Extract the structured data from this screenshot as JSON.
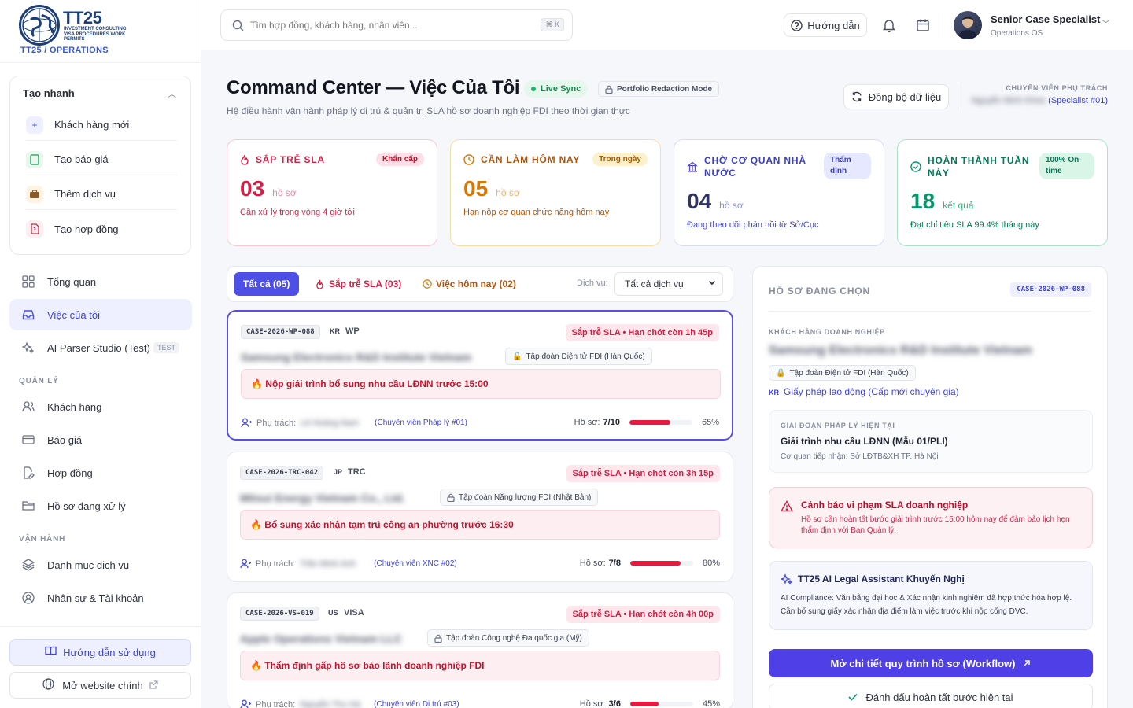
{
  "brand": {
    "name": "TT25",
    "sub": "INVESTMENT CONSULTING VISA PROCEDURES WORK PERMITS",
    "tenant": "TT25 / OPERATIONS"
  },
  "quick_create": {
    "title": "Tạo nhanh",
    "items": [
      {
        "label": "Khách hàng mới",
        "icon": "plus-icon"
      },
      {
        "label": "Tạo báo giá",
        "icon": "document-icon"
      },
      {
        "label": "Thêm dịch vụ",
        "icon": "briefcase-icon"
      },
      {
        "label": "Tạo hợp đồng",
        "icon": "contract-icon"
      }
    ]
  },
  "nav": {
    "overview": "Tổng quan",
    "my_work": "Việc của tôi",
    "ai_parser": "AI Parser Studio (Test)",
    "ai_parser_tag": "TEST",
    "section_manage": "QUẢN LÝ",
    "customers": "Khách hàng",
    "quotes": "Báo giá",
    "contracts": "Hợp đồng",
    "cases": "Hồ sơ đang xử lý",
    "section_ops": "VẬN HÀNH",
    "services": "Danh mục dịch vụ",
    "staff": "Nhân sự & Tài khoản",
    "guide_button": "Hướng dẫn sử dụng",
    "website_button": "Mở website chính"
  },
  "topbar": {
    "search_placeholder": "Tìm hợp đồng, khách hàng, nhân viên...",
    "shortcut": "⌘ K",
    "help": "Hướng dẫn",
    "user_name": "Senior Case Specialist",
    "user_role": "Operations OS"
  },
  "header": {
    "title": "Command Center — Việc Của Tôi",
    "live": "Live Sync",
    "redaction": "Portfolio Redaction Mode",
    "subtitle": "Hệ điều hành vận hành pháp lý di trú & quản trị SLA hồ sơ doanh nghiệp FDI theo thời gian thực",
    "sync_button": "Đồng bộ dữ liệu",
    "owner_label": "CHUYÊN VIÊN PHỤ TRÁCH",
    "owner_name": "Nguyễn Minh Khoa",
    "owner_role": "(Specialist #01)"
  },
  "stats": [
    {
      "title": "SẮP TRỄ SLA",
      "badge": "Khẩn cấp",
      "value": "03",
      "unit": "hồ sơ",
      "desc": "Cần xử lý trong vòng 4 giờ tới",
      "accent": "#e11d48"
    },
    {
      "title": "CẦN LÀM HÔM NAY",
      "badge": "Trong ngày",
      "value": "05",
      "unit": "hồ sơ",
      "desc": "Hạn nộp cơ quan chức năng hôm nay",
      "accent": "#d97706"
    },
    {
      "title": "CHỜ CƠ QUAN NHÀ NƯỚC",
      "badge": "Thẩm định",
      "value": "04",
      "unit": "hồ sơ",
      "desc": "Đang theo dõi phản hồi từ Sở/Cục",
      "accent": "#4f46e5"
    },
    {
      "title": "HOÀN THÀNH TUẦN NÀY",
      "badge": "100% On-time",
      "value": "18",
      "unit": "kết quả",
      "desc": "Đạt chỉ tiêu SLA 99.4% tháng này",
      "accent": "#059669"
    }
  ],
  "filters": {
    "all": "Tất cả (05)",
    "sla": "Sắp trễ SLA (03)",
    "today": "Việc hôm nay (02)",
    "service_label": "Dịch vụ:",
    "service_value": "Tất cả dịch vụ"
  },
  "cases": [
    {
      "id": "CASE-2026-WP-088",
      "country": "KR",
      "type": "WP",
      "sla": "Sắp trễ SLA • Hạn chót còn 1h 45p",
      "company": "Samsung Electronics R&D Institute Vietnam",
      "group": "Tập đoàn Điện tử FDI (Hàn Quốc)",
      "task": "🔥 Nộp giải trình bổ sung nhu cầu LĐNN trước 15:00",
      "owner_label": "Phụ trách:",
      "owner": "Lê Hoàng Nam",
      "owner_role": "(Chuyên viên Pháp lý #01)",
      "docs_label": "Hồ sơ:",
      "docs": "7/10",
      "progress": 65,
      "progress_text": "65%"
    },
    {
      "id": "CASE-2026-TRC-042",
      "country": "JP",
      "type": "TRC",
      "sla": "Sắp trễ SLA • Hạn chót còn 3h 15p",
      "company": "Mitsui Energy Vietnam Co., Ltd.",
      "group": "Tập đoàn Năng lượng FDI (Nhật Bản)",
      "task": "🔥 Bổ sung xác nhận tạm trú công an phường trước 16:30",
      "owner_label": "Phụ trách:",
      "owner": "Trần Minh Anh",
      "owner_role": "(Chuyên viên XNC #02)",
      "docs_label": "Hồ sơ:",
      "docs": "7/8",
      "progress": 80,
      "progress_text": "80%"
    },
    {
      "id": "CASE-2026-VS-019",
      "country": "US",
      "type": "VISA",
      "sla": "Sắp trễ SLA • Hạn chót còn 4h 00p",
      "company": "Apple Operations Vietnam LLC",
      "group": "Tập đoàn Công nghệ Đa quốc gia (Mỹ)",
      "task": "🔥 Thẩm định gấp hồ sơ bảo lãnh doanh nghiệp FDI",
      "owner_label": "Phụ trách:",
      "owner": "Nguyễn Thu Hà",
      "owner_role": "(Chuyên viên Di trú #03)",
      "docs_label": "Hồ sơ:",
      "docs": "3/6",
      "progress": 45,
      "progress_text": "45%"
    }
  ],
  "detail": {
    "title": "HỒ SƠ ĐANG CHỌN",
    "case_id": "CASE-2026-WP-088",
    "client_label": "KHÁCH HÀNG DOANH NGHIỆP",
    "client": "Samsung Electronics R&D Institute Vietnam",
    "group": "Tập đoàn Điện tử FDI (Hàn Quốc)",
    "service_cc": "KR",
    "service": "Giấy phép lao động (Cấp mới chuyên gia)",
    "stage_label": "GIAI ĐOẠN PHÁP LÝ HIỆN TẠI",
    "stage": "Giải trình nhu cầu LĐNN (Mẫu 01/PLI)",
    "agency": "Cơ quan tiếp nhận: Sở LĐTB&XH TP. Hà Nội",
    "alert_title": "Cảnh báo vi phạm SLA doanh nghiệp",
    "alert_text": "Hồ sơ cần hoàn tất bước giải trình trước 15:00 hôm nay để đảm bảo lịch hẹn thẩm định với Ban Quản lý.",
    "ai_title": "TT25 AI Legal Assistant Khuyến Nghị",
    "ai_text": "AI Compliance: Văn bằng đại học & Xác nhận kinh nghiệm đã hợp thức hóa hợp lệ. Cần bổ sung giấy xác nhận địa điểm làm việc trước khi nộp cổng DVC.",
    "primary_button": "Mở chi tiết quy trình hồ sơ (Workflow)",
    "secondary_button": "Đánh dấu hoàn tất bước hiện tại"
  }
}
